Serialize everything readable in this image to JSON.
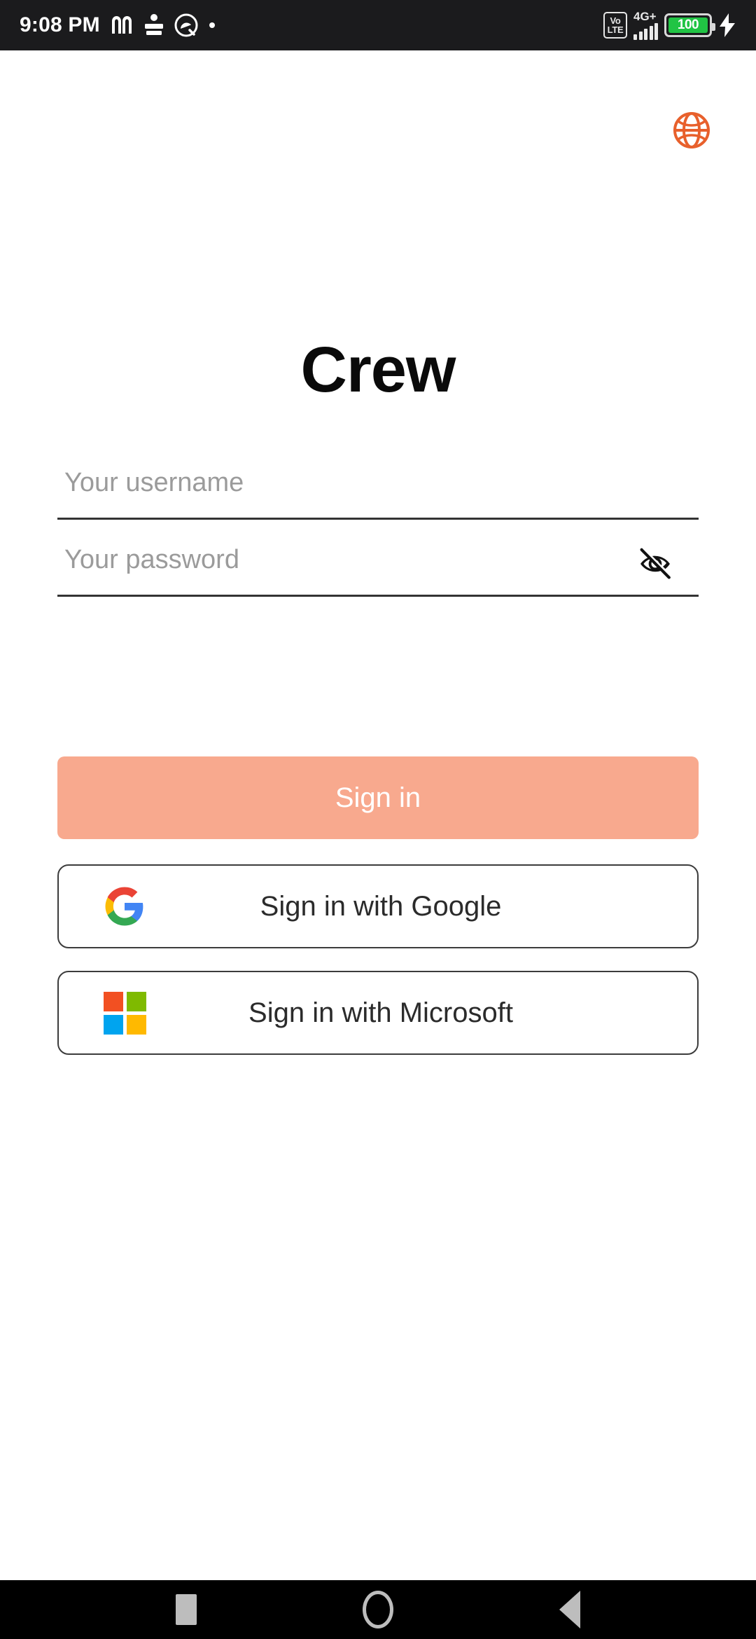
{
  "status_bar": {
    "time": "9:08 PM",
    "notification_icons": [
      "medium-m-icon",
      "gujarati-news-icon",
      "circle-logo-icon",
      "dot-icon"
    ],
    "volte_line1": "Vo",
    "volte_line2": "LTE",
    "network_type": "4G+",
    "signal_bars": 5,
    "battery_percent": "100",
    "battery_color": "#21c444",
    "charging": true,
    "background": "#1b1b1d"
  },
  "header": {
    "language_icon": "globe-icon",
    "globe_color": "#e8602c"
  },
  "app": {
    "title": "Crew"
  },
  "form": {
    "username": {
      "placeholder": "Your username",
      "value": ""
    },
    "password": {
      "placeholder": "Your password",
      "value": "",
      "visibility_icon": "eye-off-icon",
      "visible": false
    }
  },
  "actions": {
    "sign_in": {
      "label": "Sign in",
      "background": "#f8a98e",
      "text_color": "#ffffff"
    },
    "google": {
      "label": "Sign in with Google",
      "icon": "google-g-icon"
    },
    "microsoft": {
      "label": "Sign in with Microsoft",
      "icon": "microsoft-squares-icon",
      "colors": [
        "#f25022",
        "#7fba00",
        "#00a4ef",
        "#ffb900"
      ]
    }
  },
  "nav_bar": {
    "recents": "recents-square-icon",
    "home": "home-circle-icon",
    "back": "back-triangle-icon",
    "background": "#000000",
    "icon_color": "#bdbdbd"
  }
}
